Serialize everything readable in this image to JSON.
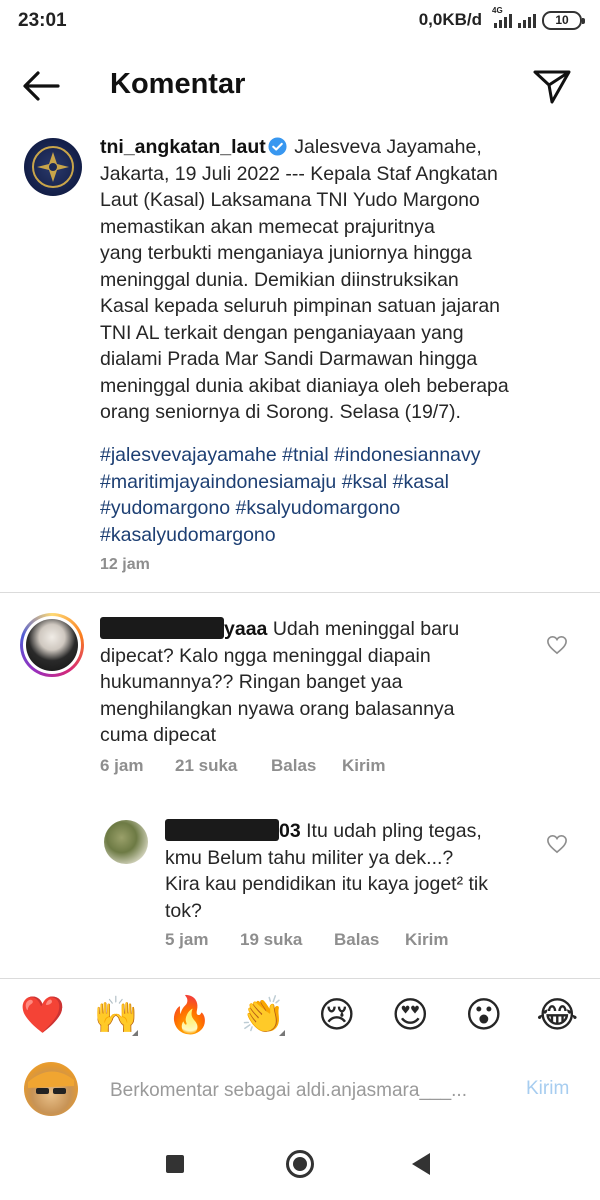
{
  "status": {
    "time": "23:01",
    "network": "0,0KB/d",
    "signal_label": "4G",
    "battery": "10"
  },
  "header": {
    "title": "Komentar"
  },
  "post": {
    "username": "tni_angkatan_laut",
    "caption_lines": [
      "Jalesveva Jayamahe,",
      "Jakarta, 19 Juli 2022 --- Kepala Staf Angkatan",
      "Laut (Kasal) Laksamana TNI Yudo Margono",
      "memastikan akan memecat prajuritnya",
      "yang terbukti menganiaya juniornya hingga",
      "meninggal dunia. Demikian diinstruksikan",
      "Kasal kepada seluruh pimpinan satuan jajaran",
      "TNI AL terkait dengan penganiayaan yang",
      "dialami Prada Mar Sandi Darmawan hingga",
      "meninggal dunia akibat dianiaya oleh beberapa",
      "orang seniornya di Sorong. Selasa (19/7)."
    ],
    "hashtag_lines": [
      "#jalesvevajayamahe #tnial #indonesiannavy",
      "#maritimjayaindonesiamaju #ksal #kasal",
      "#yudomargono #ksalyudomargono",
      "#kasalyudomargono"
    ],
    "time": "12 jam"
  },
  "comments": [
    {
      "username_visible": "yaaa",
      "text_lines": [
        "Udah meninggal baru",
        "dipecat? Kalo ngga meninggal diapain",
        "hukumannya?? Ringan banget yaa",
        "menghilangkan nyawa orang balasannya",
        "cuma dipecat"
      ],
      "time": "6 jam",
      "likes": "21 suka",
      "reply": "Balas",
      "send": "Kirim"
    },
    {
      "username_visible": "03",
      "text_lines": [
        "Itu udah pling tegas,",
        "kmu Belum tahu militer ya dek...?",
        "Kira kau pendidikan itu kaya joget² tik",
        "tok?"
      ],
      "time": "5 jam",
      "likes": "19 suka",
      "reply": "Balas",
      "send": "Kirim"
    }
  ],
  "emojis": [
    "❤️",
    "🙌",
    "🔥",
    "👏",
    "😢",
    "😍",
    "😮",
    "😂"
  ],
  "input": {
    "placeholder": "Berkomentar sebagai aldi.anjasmara___...",
    "post_label": "Kirim"
  },
  "colors": {
    "hashtag": "#1d3f73",
    "verified": "#3897f0",
    "post_disabled": "#a7cdf0",
    "meta": "#8e8e8e"
  }
}
